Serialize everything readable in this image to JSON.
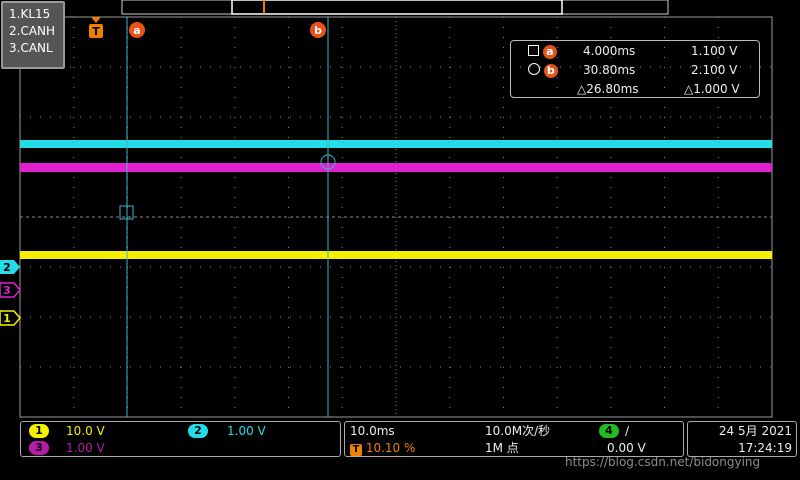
{
  "channels_legend": [
    "1.KL15",
    "2.CANH",
    "3.CANL"
  ],
  "markers": {
    "trigger": "T",
    "cursor_a": "a",
    "cursor_b": "b"
  },
  "cursor_readout": {
    "a": {
      "label": "a",
      "time": "4.000ms",
      "volt": "1.100 V"
    },
    "b": {
      "label": "b",
      "time": "30.80ms",
      "volt": "2.100 V"
    },
    "delta": {
      "time": "△26.80ms",
      "volt": "△1.000 V"
    }
  },
  "channel_markers": {
    "ch1": "1",
    "ch2": "2",
    "ch3": "3"
  },
  "bottom_bar": {
    "ch1": {
      "num": "1",
      "scale": "10.0 V"
    },
    "ch2": {
      "num": "2",
      "scale": "1.00 V"
    },
    "ch3": {
      "num": "3",
      "scale": "1.00 V"
    },
    "timebase": "10.0ms",
    "trigger_pos": "10.10 %",
    "trigger_icon": "T",
    "sample_rate": "10.0M次/秒",
    "memory": "1M 点",
    "ch4": {
      "num": "4",
      "edge": "∕",
      "level": "0.00 V"
    },
    "date": "24 5月 2021",
    "time": "17:24:19"
  },
  "watermark": "https://blog.csdn.net/bidongying",
  "colors": {
    "ch1": "#f5f000",
    "ch2": "#22dde8",
    "ch3": "#e020d0",
    "ch4": "#22bb22",
    "cursor_badge": "#e8531a",
    "grid": "#8c8c8c"
  }
}
